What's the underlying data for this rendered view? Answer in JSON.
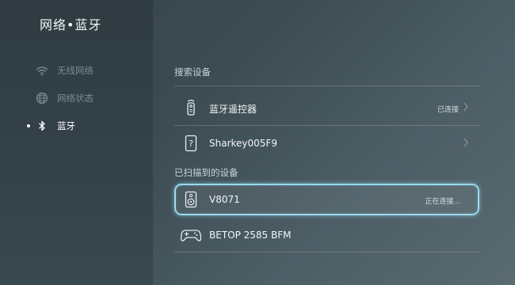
{
  "header": {
    "title": "网络•蓝牙"
  },
  "sidebar": {
    "items": [
      {
        "label": "无线网络",
        "icon": "wifi-icon",
        "active": false
      },
      {
        "label": "网络状态",
        "icon": "globe-icon",
        "active": false
      },
      {
        "label": "蓝牙",
        "icon": "bluetooth-icon",
        "active": true
      }
    ]
  },
  "main": {
    "search_section": {
      "label": "搜索设备"
    },
    "paired_devices": [
      {
        "name": "蓝牙遥控器",
        "status": "已连接",
        "icon": "remote-control-icon"
      },
      {
        "name": "Sharkey005F9",
        "status": "",
        "icon": "unknown-device-icon"
      }
    ],
    "scanned_section": {
      "label": "已扫描到的设备"
    },
    "scanned_devices": [
      {
        "name": "V8071",
        "status": "正在连接...",
        "icon": "speaker-icon",
        "focused": true
      },
      {
        "name": "BETOP 2585 BFM",
        "status": "",
        "icon": "gamepad-icon",
        "focused": false
      }
    ]
  },
  "colors": {
    "focus_border": "#9ad9ee",
    "inactive_text": "#7b8a91",
    "active_text": "#ffffff"
  }
}
